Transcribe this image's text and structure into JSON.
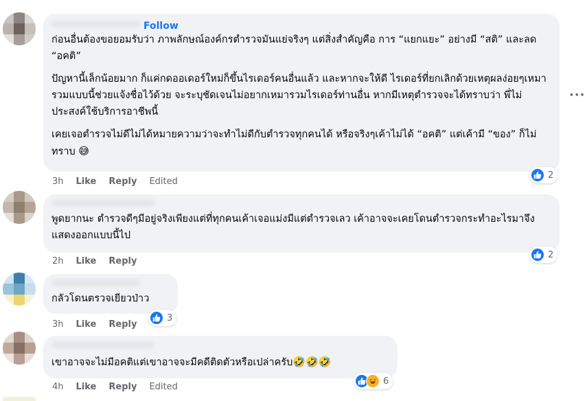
{
  "more_options_icon": "ellipsis-icon",
  "comments": [
    {
      "follow_label": "Follow",
      "paragraphs": [
        "ก่อนอื่นต้องขอยอมรับว่า ภาพลักษณ์องค์กรตำรวจมันแย่จริงๆ แต่สิ่งสำคัญคือ การ “แยกแยะ” อย่างมี “สติ” และลด “อคติ”",
        "ปัญหานี้เล็กน้อยมาก ก็แค่กดออเดอร์ใหม่ก็ขึ้นไรเดอร์คนอื่นแล้ว และหากจะให้ดี ไรเดอร์ที่ยกเลิกด้วยเหตุผลง่อยๆเหมารวมแบบนี้ช่วยแจ้งชื่อไว้ด้วย จะระบุชัดเจนไม่อยากเหมารวมไรเดอร์ท่านอื่น หากมีเหตุตำรวจจะได้ทราบว่า พี่ไม่ประสงค์ใช้บริการอาชีพนี้",
        "เคยเจอตำรวจไม่ดีไม่ได้หมายความว่าจะทำไม่ดีกับตำรวจทุกคนได้ หรือจริงๆเค้าไม่ได้ “อคติ” แต่เค้ามี “ของ” ก็ไม่ทราบ"
      ],
      "trailing_emoji": "😅",
      "time": "3h",
      "like_label": "Like",
      "reply_label": "Reply",
      "edited_label": "Edited",
      "reaction_count": "2"
    },
    {
      "paragraphs": [
        "พูดยากนะ ตำรวจดีๆมีอยู่จริงเพียงแต่ที่ทุกคนเค้าเจอแม่งมีแต่ตำรวจเลว เค้าอาจจะเคยโดนตำรวจกระทำอะไรมาจึงแสดงออกแบบนี้ไป"
      ],
      "time": "2h",
      "like_label": "Like",
      "reply_label": "Reply",
      "reaction_count": "2"
    },
    {
      "paragraphs": [
        "กลัวโดนตรวจเยียวป่าว"
      ],
      "time": "3h",
      "like_label": "Like",
      "reply_label": "Reply",
      "reaction_count": "3"
    },
    {
      "paragraphs": [
        "เขาอาจจะไม่มีอคติแต่เขาอาจจะมีคดีติดตัวหรือเปล่าครับ"
      ],
      "trailing_emoji": "🤣🤣🤣",
      "time": "4h",
      "like_label": "Like",
      "reply_label": "Reply",
      "edited_label": "Edited",
      "reaction_count": "6"
    }
  ],
  "colors": {
    "link_blue": "#1877f2",
    "bubble_bg": "#f0f2f5",
    "meta_gray": "#65676b"
  }
}
